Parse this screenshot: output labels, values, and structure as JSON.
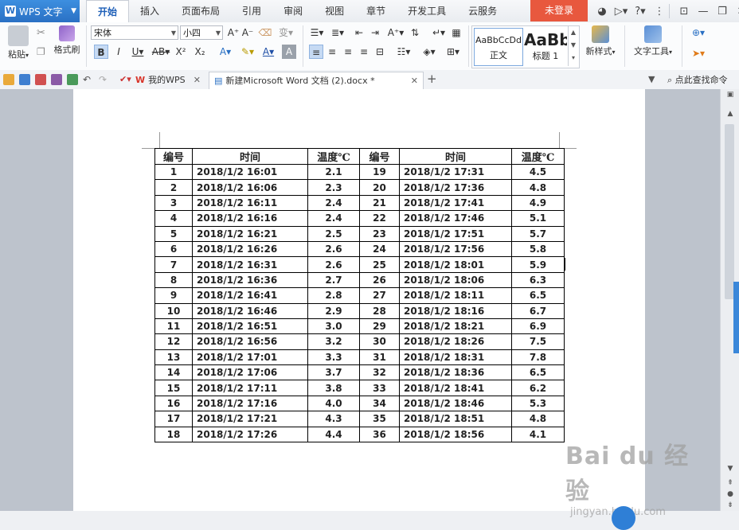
{
  "app": {
    "name": "WPS 文字"
  },
  "menu_tabs": [
    "开始",
    "插入",
    "页面布局",
    "引用",
    "审阅",
    "视图",
    "章节",
    "开发工具",
    "云服务"
  ],
  "active_tab": "开始",
  "login_label": "未登录",
  "ribbon": {
    "paste_label": "粘贴",
    "format_painter_label": "格式刷",
    "font_name": "宋体",
    "font_size": "小四",
    "style_normal_sample": "AaBbCcDd",
    "style_normal_label": "正文",
    "style_heading_sample": "AaBb",
    "style_heading_label": "标题 1",
    "new_style_label": "新样式",
    "text_tools_label": "文字工具"
  },
  "doc_tabs": [
    {
      "label": "我的WPS"
    },
    {
      "label": "新建Microsoft Word 文档 (2).docx *"
    }
  ],
  "search_command_label": "点此查找命令",
  "table": {
    "headers": [
      "编号",
      "时间",
      "温度℃",
      "编号",
      "时间",
      "温度℃"
    ],
    "rows": [
      [
        "1",
        "2018/1/2 16:01",
        "2.1",
        "19",
        "2018/1/2 17:31",
        "4.5"
      ],
      [
        "2",
        "2018/1/2 16:06",
        "2.3",
        "20",
        "2018/1/2 17:36",
        "4.8"
      ],
      [
        "3",
        "2018/1/2 16:11",
        "2.4",
        "21",
        "2018/1/2 17:41",
        "4.9"
      ],
      [
        "4",
        "2018/1/2 16:16",
        "2.4",
        "22",
        "2018/1/2 17:46",
        "5.1"
      ],
      [
        "5",
        "2018/1/2 16:21",
        "2.5",
        "23",
        "2018/1/2 17:51",
        "5.7"
      ],
      [
        "6",
        "2018/1/2 16:26",
        "2.6",
        "24",
        "2018/1/2 17:56",
        "5.8"
      ],
      [
        "7",
        "2018/1/2 16:31",
        "2.6",
        "25",
        "2018/1/2 18:01",
        "5.9"
      ],
      [
        "8",
        "2018/1/2 16:36",
        "2.7",
        "26",
        "2018/1/2 18:06",
        "6.3"
      ],
      [
        "9",
        "2018/1/2 16:41",
        "2.8",
        "27",
        "2018/1/2 18:11",
        "6.5"
      ],
      [
        "10",
        "2018/1/2 16:46",
        "2.9",
        "28",
        "2018/1/2 18:16",
        "6.7"
      ],
      [
        "11",
        "2018/1/2 16:51",
        "3.0",
        "29",
        "2018/1/2 18:21",
        "6.9"
      ],
      [
        "12",
        "2018/1/2 16:56",
        "3.2",
        "30",
        "2018/1/2 18:26",
        "7.5"
      ],
      [
        "13",
        "2018/1/2 17:01",
        "3.3",
        "31",
        "2018/1/2 18:31",
        "7.8"
      ],
      [
        "14",
        "2018/1/2 17:06",
        "3.7",
        "32",
        "2018/1/2 18:36",
        "6.5"
      ],
      [
        "15",
        "2018/1/2 17:11",
        "3.8",
        "33",
        "2018/1/2 18:41",
        "6.2"
      ],
      [
        "16",
        "2018/1/2 17:16",
        "4.0",
        "34",
        "2018/1/2 18:46",
        "5.3"
      ],
      [
        "17",
        "2018/1/2 17:21",
        "4.3",
        "35",
        "2018/1/2 18:51",
        "4.8"
      ],
      [
        "18",
        "2018/1/2 17:26",
        "4.4",
        "36",
        "2018/1/2 18:56",
        "4.1"
      ]
    ]
  },
  "watermark": {
    "main": "Bai du 经验",
    "sub": "jingyan.baidu.com"
  },
  "colors": {
    "accent": "#2a70c4",
    "login": "#e8583e",
    "active_tab_text": "#1e5fb8"
  }
}
